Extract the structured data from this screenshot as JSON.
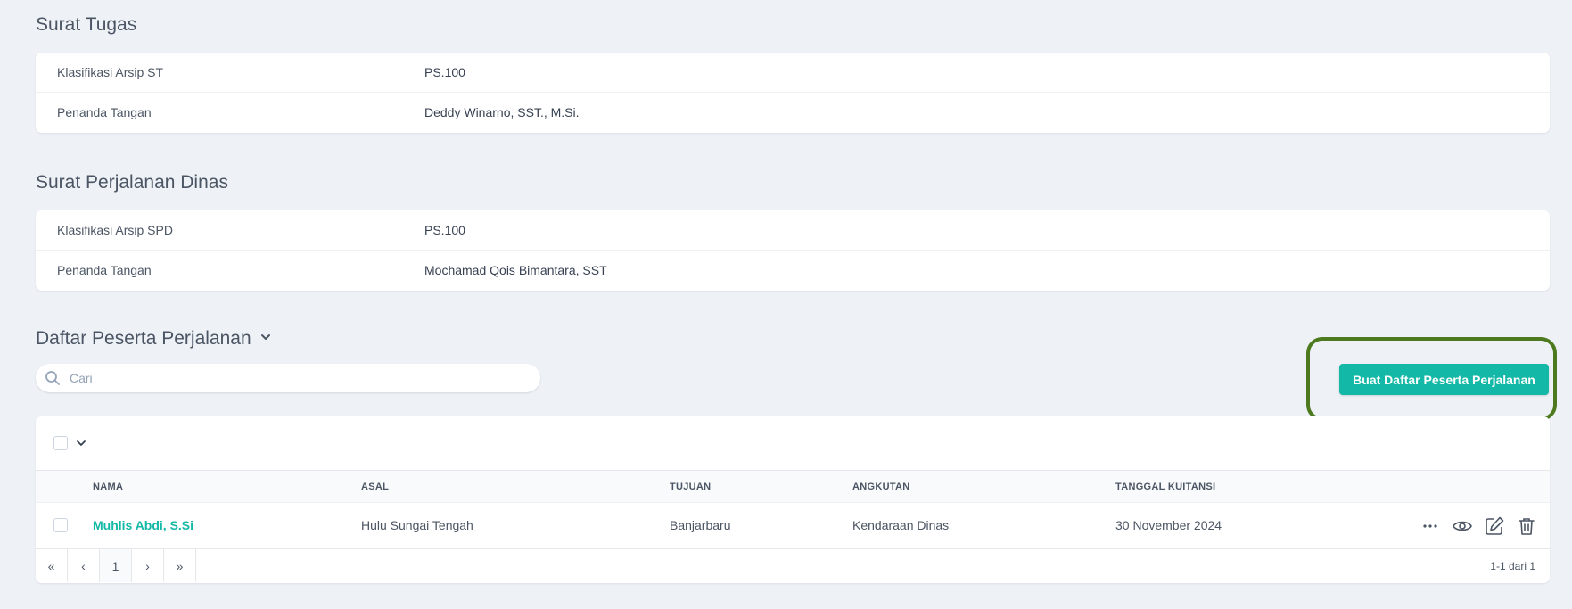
{
  "surat_tugas": {
    "title": "Surat Tugas",
    "rows": [
      {
        "label": "Klasifikasi Arsip ST",
        "value": "PS.100"
      },
      {
        "label": "Penanda Tangan",
        "value": "Deddy Winarno, SST., M.Si."
      }
    ]
  },
  "surat_perjalanan": {
    "title": "Surat Perjalanan Dinas",
    "rows": [
      {
        "label": "Klasifikasi Arsip SPD",
        "value": "PS.100"
      },
      {
        "label": "Penanda Tangan",
        "value": "Mochamad Qois Bimantara, SST"
      }
    ]
  },
  "peserta": {
    "title": "Daftar Peserta Perjalanan",
    "search_placeholder": "Cari",
    "create_button": "Buat Daftar Peserta Perjalanan",
    "columns": [
      "NAMA",
      "ASAL",
      "TUJUAN",
      "ANGKUTAN",
      "TANGGAL KUITANSI"
    ],
    "rows": [
      {
        "nama": "Muhlis Abdi, S.Si",
        "asal": "Hulu Sungai Tengah",
        "tujuan": "Banjarbaru",
        "angkutan": "Kendaraan Dinas",
        "tanggal": "30 November 2024"
      }
    ],
    "pagination": {
      "first": "«",
      "prev": "‹",
      "current": "1",
      "next": "›",
      "last": "»",
      "info": "1-1 dari 1"
    }
  },
  "colors": {
    "accent": "#14b8a6",
    "highlight_border": "#4d7a1f",
    "background": "#eef2f7"
  },
  "icons": [
    "search-icon",
    "chevron-down-icon",
    "more-icon",
    "eye-icon",
    "edit-icon",
    "trash-icon"
  ]
}
